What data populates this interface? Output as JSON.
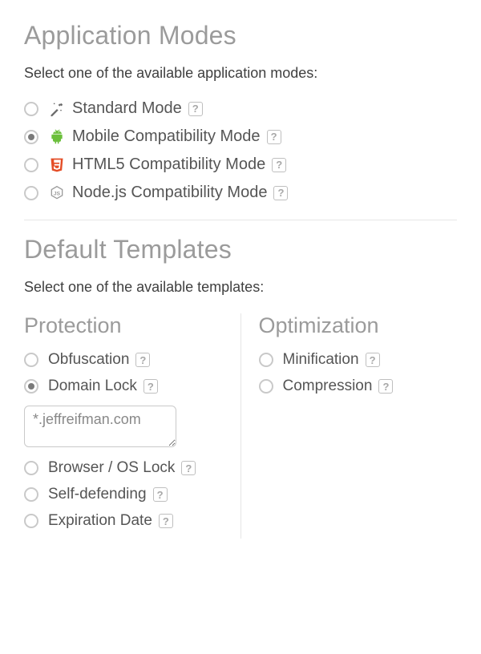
{
  "appModes": {
    "heading": "Application Modes",
    "instruction": "Select one of the available application modes:",
    "options": [
      {
        "label": "Standard Mode",
        "icon": "wand",
        "selected": false
      },
      {
        "label": "Mobile Compatibility Mode",
        "icon": "android",
        "selected": true
      },
      {
        "label": "HTML5 Compatibility Mode",
        "icon": "html5",
        "selected": false
      },
      {
        "label": "Node.js Compatibility Mode",
        "icon": "nodejs",
        "selected": false
      }
    ]
  },
  "templates": {
    "heading": "Default Templates",
    "instruction": "Select one of the available templates:",
    "protection": {
      "heading": "Protection",
      "options": [
        {
          "label": "Obfuscation",
          "selected": false
        },
        {
          "label": "Domain Lock",
          "selected": true
        },
        {
          "label": "Browser / OS Lock",
          "selected": false
        },
        {
          "label": "Self-defending",
          "selected": false
        },
        {
          "label": "Expiration Date",
          "selected": false
        }
      ],
      "domainInput": "*.jeffreifman.com"
    },
    "optimization": {
      "heading": "Optimization",
      "options": [
        {
          "label": "Minification",
          "selected": false
        },
        {
          "label": "Compression",
          "selected": false
        }
      ]
    }
  },
  "helpGlyph": "?"
}
